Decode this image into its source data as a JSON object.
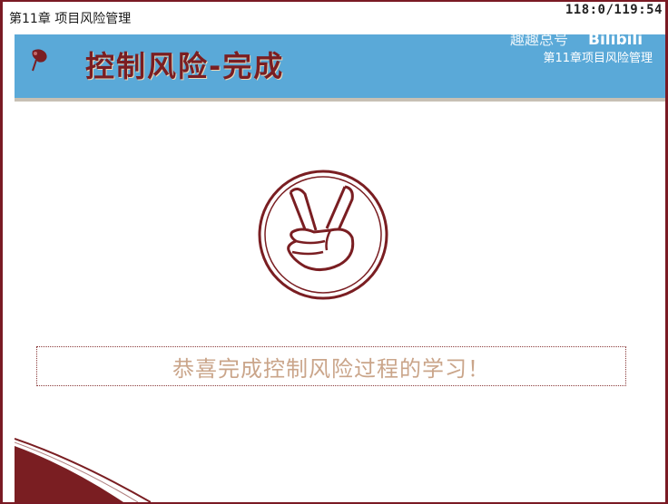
{
  "window": {
    "title": "第11章 项目风险管理",
    "timer": "118:0/119:54"
  },
  "banner": {
    "title": "控制风险-完成",
    "watermark": "趣趣总号",
    "brand": "Bilibili",
    "chapter_label": "第11章项目风险管理"
  },
  "content": {
    "emblem_icon": "victory-hand-icon",
    "message": "恭喜完成控制风险过程的学习！"
  },
  "colors": {
    "banner": "#5aa9d8",
    "title": "#7a1e22",
    "frame": "#7a1a24",
    "message": "#caa58a"
  }
}
